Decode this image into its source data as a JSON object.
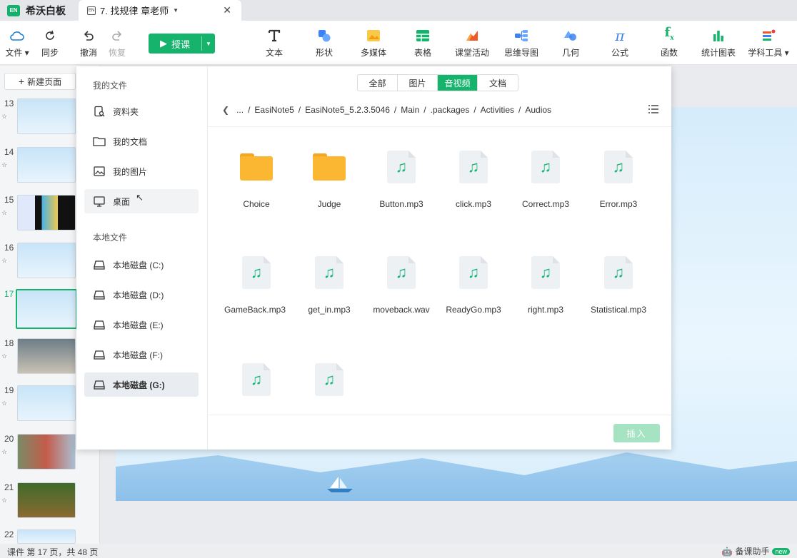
{
  "titlebar": {
    "app_logo": "EN",
    "app_name": "希沃白板",
    "doc_tab_icon": "EN",
    "doc_tab_title": "7. 找规律 章老师",
    "close_symbol": "✕"
  },
  "toolbar": {
    "file": "文件",
    "sync": "同步",
    "undo": "撤消",
    "redo": "恢复",
    "teach": "授课",
    "text": "文本",
    "shape": "形状",
    "media": "多媒体",
    "table": "表格",
    "activity": "课堂活动",
    "mindmap": "思维导图",
    "geometry": "几何",
    "formula": "公式",
    "function": "函数",
    "stats_chart": "统计图表",
    "subject_tools": "学科工具"
  },
  "slides": {
    "new_page": "新建页面",
    "items": [
      {
        "num": "13"
      },
      {
        "num": "14"
      },
      {
        "num": "15"
      },
      {
        "num": "16"
      },
      {
        "num": "17"
      },
      {
        "num": "18"
      },
      {
        "num": "19"
      },
      {
        "num": "20"
      },
      {
        "num": "21"
      },
      {
        "num": "22"
      }
    ]
  },
  "dialog": {
    "my_files_head": "我的文件",
    "folder_item": "资料夹",
    "my_docs": "我的文档",
    "my_pics": "我的图片",
    "desktop": "桌面",
    "local_head": "本地文件",
    "drives": [
      "本地磁盘 (C:)",
      "本地磁盘 (D:)",
      "本地磁盘 (E:)",
      "本地磁盘 (F:)",
      "本地磁盘 (G:)"
    ],
    "tabs": [
      "全部",
      "图片",
      "音视频",
      "文档"
    ],
    "active_tab": "音视频",
    "path": {
      "ellipsis": "...",
      "segments": [
        "EasiNote5",
        "EasiNote5_5.2.3.5046",
        "Main",
        ".packages",
        "Activities",
        "Audios"
      ]
    },
    "files": [
      {
        "name": "Choice",
        "type": "folder"
      },
      {
        "name": "Judge",
        "type": "folder"
      },
      {
        "name": "Button.mp3",
        "type": "audio"
      },
      {
        "name": "click.mp3",
        "type": "audio"
      },
      {
        "name": "Correct.mp3",
        "type": "audio"
      },
      {
        "name": "Error.mp3",
        "type": "audio"
      },
      {
        "name": "GameBack.mp3",
        "type": "audio"
      },
      {
        "name": "get_in.mp3",
        "type": "audio"
      },
      {
        "name": "moveback.wav",
        "type": "audio"
      },
      {
        "name": "ReadyGo.mp3",
        "type": "audio"
      },
      {
        "name": "right.mp3",
        "type": "audio"
      },
      {
        "name": "Statistical.mp3",
        "type": "audio"
      },
      {
        "name": "",
        "type": "audio"
      },
      {
        "name": "",
        "type": "audio"
      }
    ],
    "insert": "插入"
  },
  "status": {
    "page_info": "课件 第 17 页，共 48 页",
    "helper": "备课助手",
    "new_badge": "new"
  },
  "colors": {
    "brand_green": "#15b36b",
    "folder_yellow": "#fbb731",
    "audio_green": "#13b774"
  }
}
